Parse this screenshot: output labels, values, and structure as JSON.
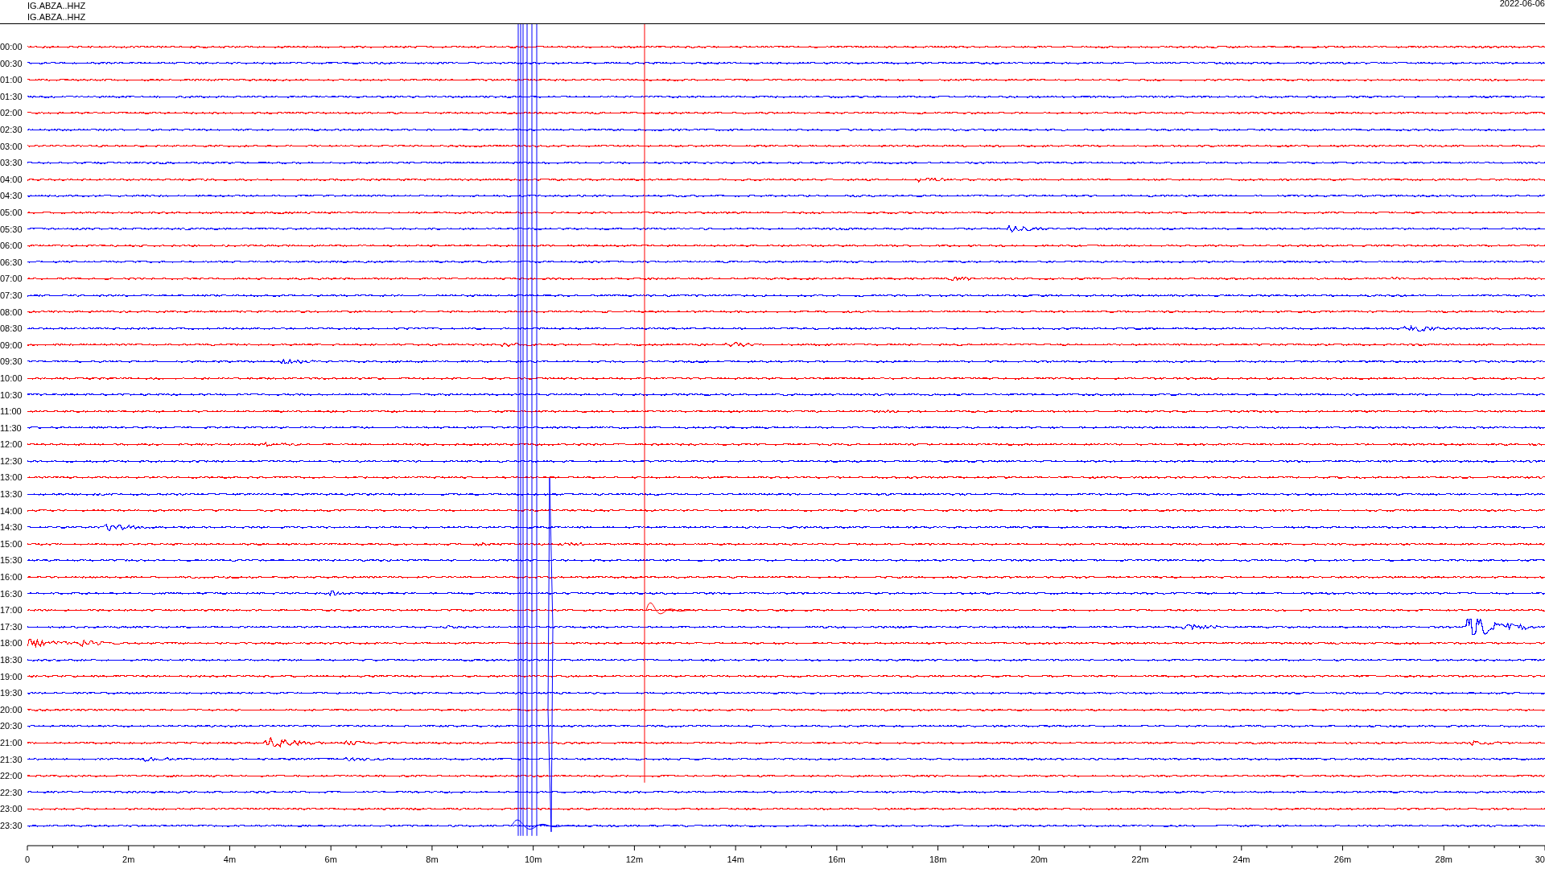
{
  "header": {
    "channels": [
      "IG.ABZA..HHZ",
      "IG.ABZA..HHZ"
    ],
    "date": "2022-06-06"
  },
  "rows": [
    {
      "label": "00:00",
      "color": "#ff0000"
    },
    {
      "label": "00:30",
      "color": "#0000ff"
    },
    {
      "label": "01:00",
      "color": "#ff0000"
    },
    {
      "label": "01:30",
      "color": "#0000ff"
    },
    {
      "label": "02:00",
      "color": "#ff0000"
    },
    {
      "label": "02:30",
      "color": "#0000ff"
    },
    {
      "label": "03:00",
      "color": "#ff0000"
    },
    {
      "label": "03:30",
      "color": "#0000ff"
    },
    {
      "label": "04:00",
      "color": "#ff0000"
    },
    {
      "label": "04:30",
      "color": "#0000ff"
    },
    {
      "label": "05:00",
      "color": "#ff0000"
    },
    {
      "label": "05:30",
      "color": "#0000ff"
    },
    {
      "label": "06:00",
      "color": "#ff0000"
    },
    {
      "label": "06:30",
      "color": "#0000ff"
    },
    {
      "label": "07:00",
      "color": "#ff0000"
    },
    {
      "label": "07:30",
      "color": "#0000ff"
    },
    {
      "label": "08:00",
      "color": "#ff0000"
    },
    {
      "label": "08:30",
      "color": "#0000ff"
    },
    {
      "label": "09:00",
      "color": "#ff0000"
    },
    {
      "label": "09:30",
      "color": "#0000ff"
    },
    {
      "label": "10:00",
      "color": "#ff0000"
    },
    {
      "label": "10:30",
      "color": "#0000ff"
    },
    {
      "label": "11:00",
      "color": "#ff0000"
    },
    {
      "label": "11:30",
      "color": "#0000ff"
    },
    {
      "label": "12:00",
      "color": "#ff0000"
    },
    {
      "label": "12:30",
      "color": "#0000ff"
    },
    {
      "label": "13:00",
      "color": "#ff0000"
    },
    {
      "label": "13:30",
      "color": "#0000ff"
    },
    {
      "label": "14:00",
      "color": "#ff0000"
    },
    {
      "label": "14:30",
      "color": "#0000ff"
    },
    {
      "label": "15:00",
      "color": "#ff0000"
    },
    {
      "label": "15:30",
      "color": "#0000ff"
    },
    {
      "label": "16:00",
      "color": "#ff0000"
    },
    {
      "label": "16:30",
      "color": "#0000ff"
    },
    {
      "label": "17:00",
      "color": "#ff0000"
    },
    {
      "label": "17:30",
      "color": "#0000ff"
    },
    {
      "label": "18:00",
      "color": "#ff0000"
    },
    {
      "label": "18:30",
      "color": "#0000ff"
    },
    {
      "label": "19:00",
      "color": "#ff0000"
    },
    {
      "label": "19:30",
      "color": "#0000ff"
    },
    {
      "label": "20:00",
      "color": "#ff0000"
    },
    {
      "label": "20:30",
      "color": "#0000ff"
    },
    {
      "label": "21:00",
      "color": "#ff0000"
    },
    {
      "label": "21:30",
      "color": "#0000ff"
    },
    {
      "label": "22:00",
      "color": "#ff0000"
    },
    {
      "label": "22:30",
      "color": "#0000ff"
    },
    {
      "label": "23:00",
      "color": "#ff0000"
    },
    {
      "label": "23:30",
      "color": "#0000ff"
    }
  ],
  "x_axis": {
    "ticks": [
      "0",
      "2m",
      "4m",
      "6m",
      "8m",
      "10m",
      "12m",
      "14m",
      "16m",
      "18m",
      "20m",
      "22m",
      "24m",
      "26m",
      "28m",
      "30"
    ]
  }
}
